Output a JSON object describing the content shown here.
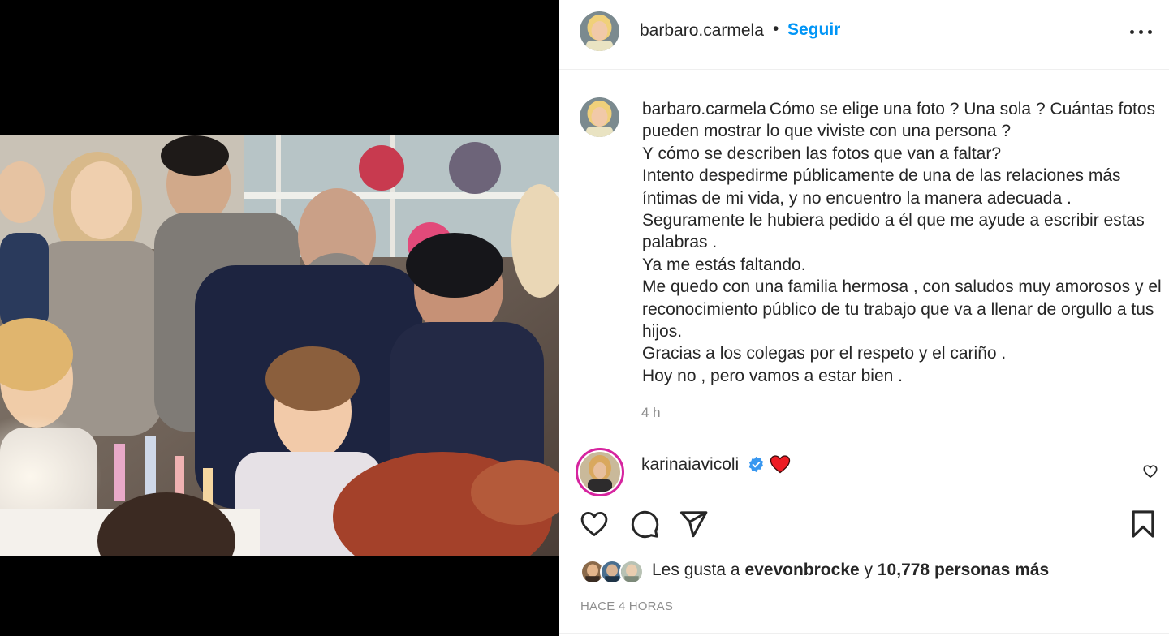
{
  "post": {
    "author": "barbaro.carmela",
    "separator": "•",
    "follow_label": "Seguir",
    "more_icon": "more-options-icon",
    "caption_lines": [
      "Cómo se elige una foto ? Una sola ? Cuántas fotos pueden mostrar lo que viviste con una persona ?",
      "Y cómo se describen las fotos que van a faltar?",
      "Intento despedirme públicamente de una de las relaciones más íntimas de mi vida, y no encuentro la manera adecuada .",
      "Seguramente le hubiera pedido a él que me ayude a escribir estas palabras .",
      "Ya me estás faltando.",
      "Me quedo con una familia hermosa , con saludos muy amorosos y el reconocimiento público de tu trabajo que va a llenar de orgullo a tus hijos.",
      "Gracias a los colegas por el respeto y el cariño .",
      "Hoy no , pero vamos a estar bien ."
    ],
    "caption_age": "4 h"
  },
  "comment": {
    "user": "karinaiavicoli",
    "verified_icon": "verified-badge-icon",
    "emoji": "red-heart-emoji"
  },
  "actions": {
    "like_icon": "heart-icon",
    "comment_icon": "comment-icon",
    "share_icon": "share-icon",
    "save_icon": "bookmark-icon"
  },
  "likes": {
    "prefix": "Les gusta a",
    "top_liker": "evevonbrocke",
    "joiner": "y",
    "others": "10,778 personas más"
  },
  "timestamp": "HACE 4 HORAS",
  "colors": {
    "accent": "#0095f6",
    "text": "#262626",
    "muted": "#8e8e8e",
    "border": "#efefef",
    "heart": "#ed1c24"
  }
}
